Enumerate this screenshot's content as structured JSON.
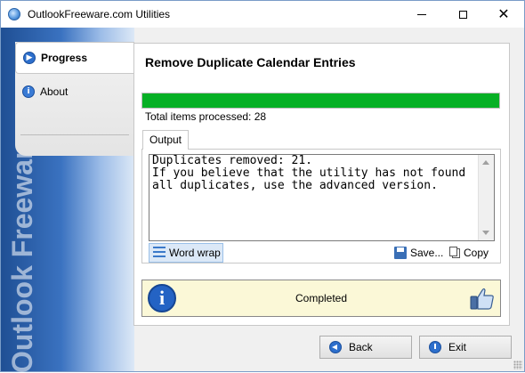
{
  "window": {
    "title": "OutlookFreeware.com Utilities"
  },
  "sidebar": {
    "items": [
      {
        "label": "Progress",
        "icon": "play-icon",
        "active": true
      },
      {
        "label": "About",
        "icon": "info-icon",
        "active": false
      }
    ],
    "brand": "Outlook Freeware .com"
  },
  "main": {
    "title": "Remove Duplicate Calendar Entries",
    "progress": 1.0,
    "processed": "Total items processed: 28",
    "tab": "Output",
    "output_text": "Duplicates removed: 21.\nIf you believe that the utility has not found\nall duplicates, use the advanced version.",
    "word_wrap_label": "Word wrap",
    "save_label": "Save...",
    "copy_label": "Copy",
    "status_text": "Completed"
  },
  "buttons": {
    "back": "Back",
    "exit": "Exit"
  },
  "colors": {
    "progress": "#06b025",
    "status_bg": "#fbf8d7",
    "accent": "#2463c4"
  }
}
